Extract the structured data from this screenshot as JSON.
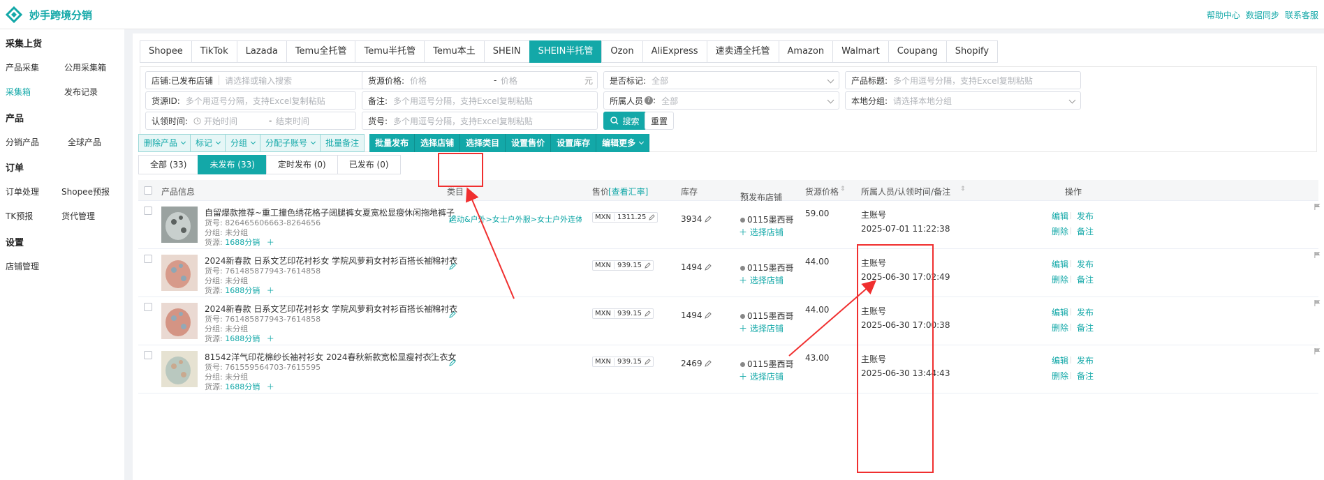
{
  "app": {
    "title": "妙手跨境分销"
  },
  "top_links": [
    "帮助中心",
    "数据同步",
    "联系客服"
  ],
  "sidebar": {
    "sections": [
      {
        "title": "采集上货",
        "items": [
          "产品采集",
          "公用采集箱",
          "采集箱",
          "发布记录"
        ]
      },
      {
        "title": "产品",
        "items": [
          "分销产品",
          "全球产品"
        ]
      },
      {
        "title": "订单",
        "items": [
          "订单处理",
          "Shopee预报",
          "TK预报",
          "货代管理"
        ]
      },
      {
        "title": "设置",
        "items": [
          "店铺管理"
        ]
      }
    ],
    "active_item": "采集箱"
  },
  "platform_tabs": [
    "Shopee",
    "TikTok",
    "Lazada",
    "Temu全托管",
    "Temu半托管",
    "Temu本土",
    "SHEIN",
    "SHEIN半托管",
    "Ozon",
    "AliExpress",
    "速卖通全托管",
    "Amazon",
    "Walmart",
    "Coupang",
    "Shopify"
  ],
  "active_platform": "SHEIN半托管",
  "filters": {
    "shop": {
      "label": "店铺:",
      "value": "已发布店铺",
      "placeholder": "请选择或输入搜索"
    },
    "supply_price": {
      "label": "货源价格:",
      "ph_min": "价格",
      "dash": "-",
      "ph_max": "价格",
      "unit": "元"
    },
    "marked": {
      "label": "是否标记:",
      "value": "全部"
    },
    "title": {
      "label": "产品标题:",
      "placeholder": "多个用逗号分隔，支持Excel复制粘贴"
    },
    "source_id": {
      "label": "货源ID:",
      "placeholder": "多个用逗号分隔，支持Excel复制粘贴"
    },
    "remark": {
      "label": "备注:",
      "placeholder": "多个用逗号分隔，支持Excel复制粘贴"
    },
    "owner": {
      "label": "所属人员",
      "value": "全部"
    },
    "local_group": {
      "label": "本地分组:",
      "placeholder": "请选择本地分组"
    },
    "claim_time": {
      "label": "认领时间:",
      "ph_start": "开始时间",
      "dash": "-",
      "ph_end": "结束时间"
    },
    "sku": {
      "label": "货号:",
      "placeholder": "多个用逗号分隔，支持Excel复制粘贴"
    },
    "search_btn": "搜索",
    "reset_btn": "重置"
  },
  "actions_light": [
    "删除产品",
    "标记",
    "分组",
    "分配子账号",
    "批量备注"
  ],
  "actions_dark": [
    "批量发布",
    "选择店铺",
    "选择类目",
    "设置售价",
    "设置库存",
    "编辑更多"
  ],
  "status_tabs": [
    "全部 (33)",
    "未发布 (33)",
    "定时发布 (0)",
    "已发布 (0)"
  ],
  "active_status": "未发布 (33)",
  "table": {
    "headers": {
      "product": "产品信息",
      "category": "类目",
      "price": "售价",
      "rate_link": "[查看汇率]",
      "stock": "库存",
      "pre_shop": "预发布店铺",
      "cost": "货源价格",
      "owner": "所属人员/认领时间/备注",
      "ops": "操作"
    },
    "rows": [
      {
        "name": "自留爆款推荐~重工撞色绣花格子阔腿裤女夏宽松显瘦休闲拖地裤子",
        "sku": "货号: 826465606663-8264656",
        "group": "分组: 未分组",
        "source_label": "货源:",
        "source": "1688分销",
        "category": "运动&户外>女士户外服>女士户外连体衣&连...",
        "currency": "MXN",
        "price": "1311.25",
        "stock": "3934",
        "shop": "0115墨西哥",
        "select_shop": "选择店铺",
        "cost": "59.00",
        "account": "主账号",
        "time": "2025-07-01 11:22:38"
      },
      {
        "name": "2024新春款 日系文艺印花衬衫女 学院风萝莉女衬衫百搭长袖棉衬衣",
        "sku": "货号: 761485877943-7614858",
        "group": "分组: 未分组",
        "source_label": "货源:",
        "source": "1688分销",
        "category": "",
        "currency": "MXN",
        "price": "939.15",
        "stock": "1494",
        "shop": "0115墨西哥",
        "select_shop": "选择店铺",
        "cost": "44.00",
        "account": "主账号",
        "time": "2025-06-30 17:02:49"
      },
      {
        "name": "2024新春款 日系文艺印花衬衫女 学院风萝莉女衬衫百搭长袖棉衬衣",
        "sku": "货号: 761485877943-7614858",
        "group": "分组: 未分组",
        "source_label": "货源:",
        "source": "1688分销",
        "category": "",
        "currency": "MXN",
        "price": "939.15",
        "stock": "1494",
        "shop": "0115墨西哥",
        "select_shop": "选择店铺",
        "cost": "44.00",
        "account": "主账号",
        "time": "2025-06-30 17:00:38"
      },
      {
        "name": "81542洋气印花棉纱长袖衬衫女 2024春秋新款宽松显瘦衬衣上衣女",
        "sku": "货号: 761559564703-7615595",
        "group": "分组: 未分组",
        "source_label": "货源:",
        "source": "1688分销",
        "category": "",
        "currency": "MXN",
        "price": "939.15",
        "stock": "2469",
        "shop": "0115墨西哥",
        "select_shop": "选择店铺",
        "cost": "43.00",
        "account": "主账号",
        "time": "2025-06-30 13:44:43"
      }
    ],
    "ops": {
      "edit": "编辑",
      "publish": "发布",
      "delete": "删除",
      "remark": "备注"
    }
  },
  "colors": {
    "accent": "#13a8a8",
    "annotation": "#f02f2f"
  }
}
